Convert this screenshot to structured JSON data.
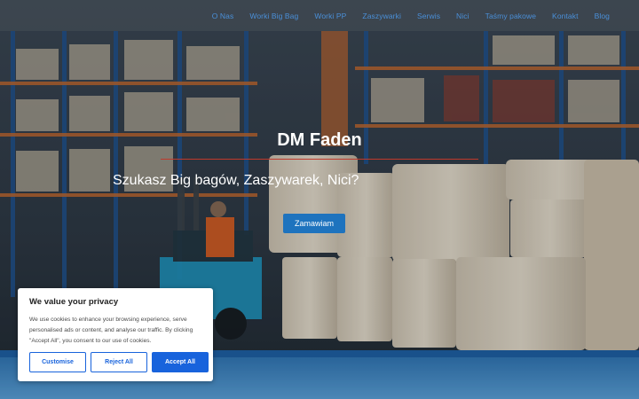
{
  "nav": {
    "items": [
      {
        "label": "O Nas"
      },
      {
        "label": "Worki Big Bag"
      },
      {
        "label": "Worki PP"
      },
      {
        "label": "Zaszywarki"
      },
      {
        "label": "Serwis"
      },
      {
        "label": "Nici"
      },
      {
        "label": "Taśmy pakowe"
      },
      {
        "label": "Kontakt"
      },
      {
        "label": "Blog"
      }
    ]
  },
  "hero": {
    "title": "DM Faden",
    "subtitle": "Szukasz Big bagów, Zaszywarek, Nici?",
    "cta_label": "Zamawiam"
  },
  "cookie_banner": {
    "title": "We value your privacy",
    "text": "We use cookies to enhance your browsing experience, serve personalised ads or content, and analyse our traffic. By clicking \"Accept All\", you consent to our use of cookies.",
    "customise_label": "Customise",
    "reject_label": "Reject All",
    "accept_label": "Accept All"
  },
  "colors": {
    "nav_link": "#4a8fd8",
    "cta": "#1e73be",
    "cookie_accent": "#1863dc",
    "title_rule": "#c0392b"
  }
}
